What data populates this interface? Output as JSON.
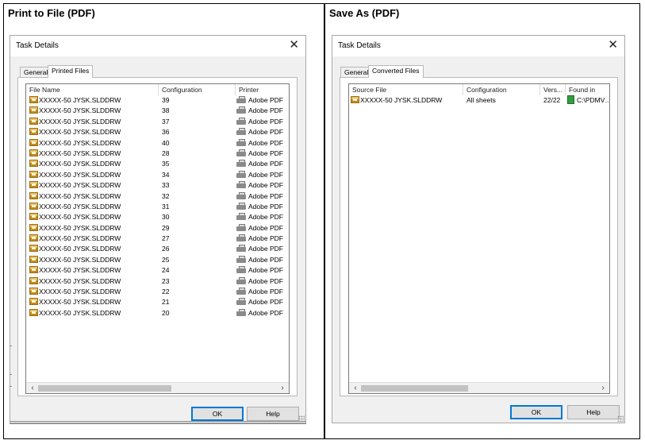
{
  "left": {
    "caption": "Print to File (PDF)",
    "dialog": {
      "title": "Task Details",
      "tabs": [
        "General",
        "Printed Files"
      ],
      "active_tab": 1,
      "columns": [
        "File Name",
        "Configuration",
        "Printer"
      ],
      "rows": [
        {
          "file": "XXXXX-50 JYSK.SLDDRW",
          "configuration": "39",
          "printer": "Adobe PDF"
        },
        {
          "file": "XXXXX-50 JYSK.SLDDRW",
          "configuration": "38",
          "printer": "Adobe PDF"
        },
        {
          "file": "XXXXX-50 JYSK.SLDDRW",
          "configuration": "37",
          "printer": "Adobe PDF"
        },
        {
          "file": "XXXXX-50 JYSK.SLDDRW",
          "configuration": "36",
          "printer": "Adobe PDF"
        },
        {
          "file": "XXXXX-50 JYSK.SLDDRW",
          "configuration": "40",
          "printer": "Adobe PDF"
        },
        {
          "file": "XXXXX-50 JYSK.SLDDRW",
          "configuration": "28",
          "printer": "Adobe PDF"
        },
        {
          "file": "XXXXX-50 JYSK.SLDDRW",
          "configuration": "35",
          "printer": "Adobe PDF"
        },
        {
          "file": "XXXXX-50 JYSK.SLDDRW",
          "configuration": "34",
          "printer": "Adobe PDF"
        },
        {
          "file": "XXXXX-50 JYSK.SLDDRW",
          "configuration": "33",
          "printer": "Adobe PDF"
        },
        {
          "file": "XXXXX-50 JYSK.SLDDRW",
          "configuration": "32",
          "printer": "Adobe PDF"
        },
        {
          "file": "XXXXX-50 JYSK.SLDDRW",
          "configuration": "31",
          "printer": "Adobe PDF"
        },
        {
          "file": "XXXXX-50 JYSK.SLDDRW",
          "configuration": "30",
          "printer": "Adobe PDF"
        },
        {
          "file": "XXXXX-50 JYSK.SLDDRW",
          "configuration": "29",
          "printer": "Adobe PDF"
        },
        {
          "file": "XXXXX-50 JYSK.SLDDRW",
          "configuration": "27",
          "printer": "Adobe PDF"
        },
        {
          "file": "XXXXX-50 JYSK.SLDDRW",
          "configuration": "26",
          "printer": "Adobe PDF"
        },
        {
          "file": "XXXXX-50 JYSK.SLDDRW",
          "configuration": "25",
          "printer": "Adobe PDF"
        },
        {
          "file": "XXXXX-50 JYSK.SLDDRW",
          "configuration": "24",
          "printer": "Adobe PDF"
        },
        {
          "file": "XXXXX-50 JYSK.SLDDRW",
          "configuration": "23",
          "printer": "Adobe PDF"
        },
        {
          "file": "XXXXX-50 JYSK.SLDDRW",
          "configuration": "22",
          "printer": "Adobe PDF"
        },
        {
          "file": "XXXXX-50 JYSK.SLDDRW",
          "configuration": "21",
          "printer": "Adobe PDF"
        },
        {
          "file": "XXXXX-50 JYSK.SLDDRW",
          "configuration": "20",
          "printer": "Adobe PDF"
        }
      ],
      "ok_label": "OK",
      "help_label": "Help"
    }
  },
  "right": {
    "caption": "Save As (PDF)",
    "dialog": {
      "title": "Task Details",
      "tabs": [
        "General",
        "Converted Files"
      ],
      "active_tab": 1,
      "columns": [
        "Source File",
        "Configuration",
        "Vers...",
        "Found in"
      ],
      "rows": [
        {
          "file": "XXXXX-50 JYSK.SLDDRW",
          "configuration": "All sheets",
          "version": "22/22",
          "found_in": "C:\\PDMV…"
        }
      ],
      "ok_label": "OK",
      "help_label": "Help"
    }
  },
  "icons": {
    "file": "drawing-file-icon",
    "printer": "printer-icon",
    "folder": "vault-folder-icon",
    "close": "close-icon",
    "scroll_left": "chevron-left-icon",
    "scroll_right": "chevron-right-icon"
  },
  "colors": {
    "default_button_border": "#0078d7",
    "dialog_background": "#f0f0f0",
    "vault_folder": "#2e9e3c"
  }
}
